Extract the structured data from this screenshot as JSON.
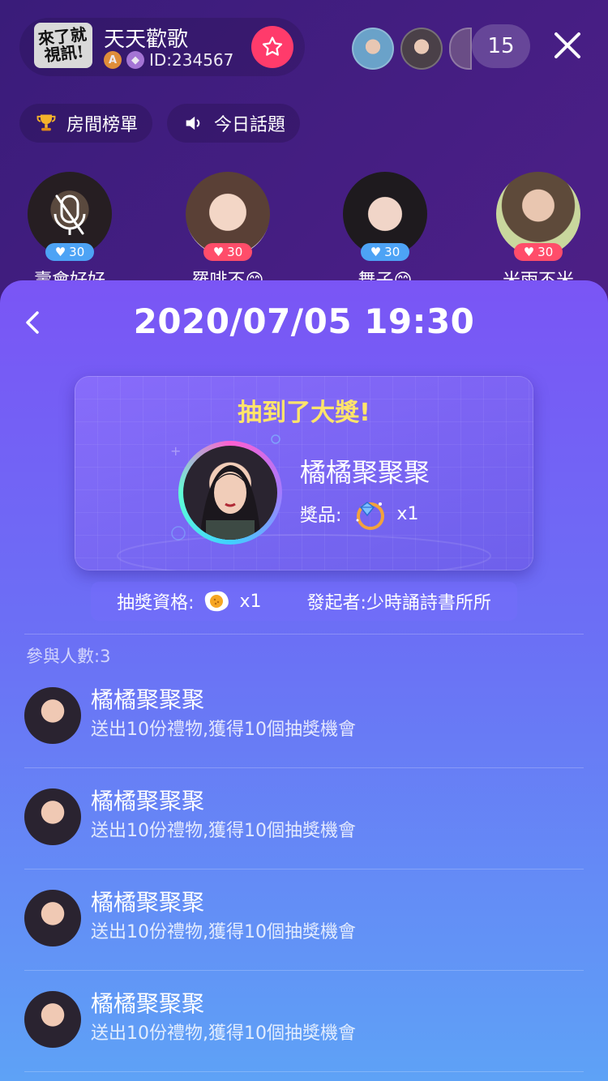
{
  "room": {
    "logo_text": "來了就\n視訊!",
    "title": "天天歡歌",
    "badge_a": "A",
    "badge_b": "◆",
    "id_text": "ID:234567",
    "viewer_count": "15"
  },
  "pills": [
    {
      "label": "房間榜單",
      "icon": "trophy-icon"
    },
    {
      "label": "今日話題",
      "icon": "speaker-icon"
    }
  ],
  "seats": [
    {
      "nick": "壽會好好",
      "likes": "30",
      "like_color": "#4da3f5",
      "muted": true
    },
    {
      "nick": "羅啡不😊",
      "likes": "30",
      "like_color": "#ff4d6a",
      "muted": false
    },
    {
      "nick": "舞子😊",
      "likes": "30",
      "like_color": "#4da3f5",
      "muted": false
    },
    {
      "nick": "米雨不米",
      "likes": "30",
      "like_color": "#ff4d6a",
      "muted": false
    }
  ],
  "sheet": {
    "title": "2020/07/05 19:30",
    "headline": "抽到了大獎!",
    "winner_name": "橘橘聚聚聚",
    "prize_label": "獎品:",
    "prize_qty": "x1",
    "qualify_label": "抽獎資格:",
    "qualify_qty": "x1",
    "initiator": "發起者:少時誦詩書所所",
    "participants_label": "參與人數:3",
    "participants": [
      {
        "name": "橘橘聚聚聚",
        "desc": "送出10份禮物,獲得10個抽獎機會"
      },
      {
        "name": "橘橘聚聚聚",
        "desc": "送出10份禮物,獲得10個抽獎機會"
      },
      {
        "name": "橘橘聚聚聚",
        "desc": "送出10份禮物,獲得10個抽獎機會"
      },
      {
        "name": "橘橘聚聚聚",
        "desc": "送出10份禮物,獲得10個抽獎機會"
      }
    ]
  },
  "colors": {
    "accent_red": "#ff3b6b",
    "headline_yellow": "#ffe46a"
  }
}
